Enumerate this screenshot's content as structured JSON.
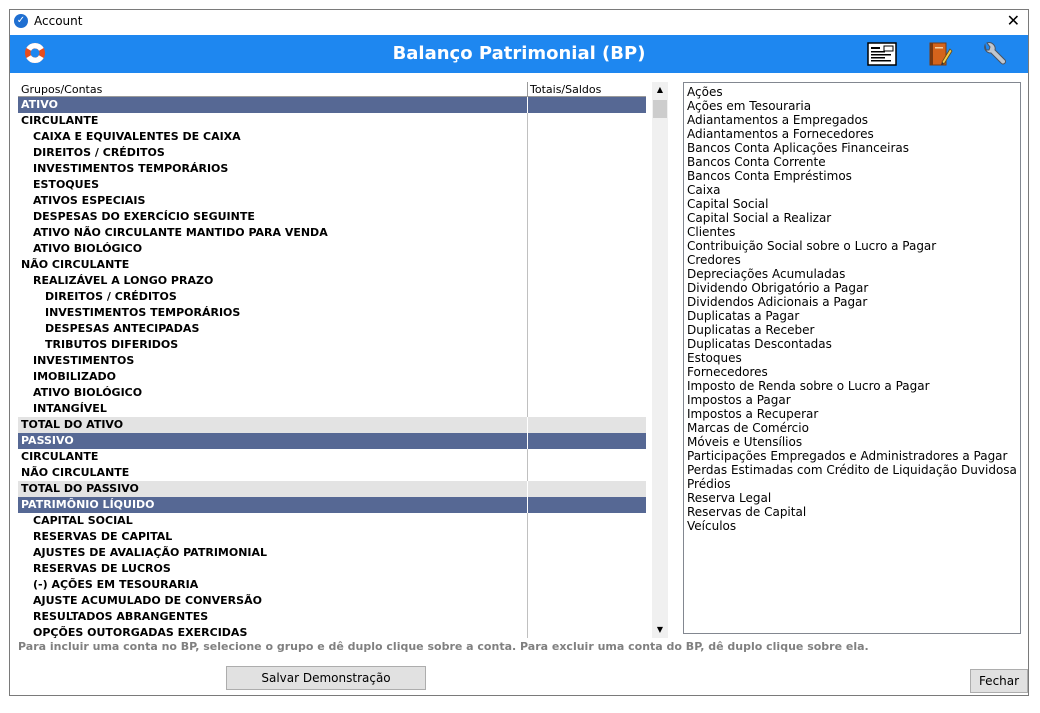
{
  "window": {
    "title": "Account",
    "close": "✕"
  },
  "header": {
    "title": "Balanço Patrimonial (BP)"
  },
  "columns": {
    "group": "Grupos/Contas",
    "totals": "Totais/Saldos"
  },
  "rows": [
    {
      "label": "ATIVO",
      "type": "section",
      "level": 0
    },
    {
      "label": "CIRCULANTE",
      "type": "bold",
      "level": 0
    },
    {
      "label": "CAIXA E EQUIVALENTES DE CAIXA",
      "type": "bold",
      "level": 1
    },
    {
      "label": "DIREITOS / CRÉDITOS",
      "type": "bold",
      "level": 1
    },
    {
      "label": "INVESTIMENTOS TEMPORÁRIOS",
      "type": "bold",
      "level": 1
    },
    {
      "label": "ESTOQUES",
      "type": "bold",
      "level": 1
    },
    {
      "label": "ATIVOS ESPECIAIS",
      "type": "bold",
      "level": 1
    },
    {
      "label": "DESPESAS DO EXERCÍCIO SEGUINTE",
      "type": "bold",
      "level": 1
    },
    {
      "label": "ATIVO NÃO CIRCULANTE MANTIDO PARA VENDA",
      "type": "bold",
      "level": 1
    },
    {
      "label": "ATIVO BIOLÓGICO",
      "type": "bold",
      "level": 1
    },
    {
      "label": "NÃO CIRCULANTE",
      "type": "bold",
      "level": 0
    },
    {
      "label": "REALIZÁVEL A LONGO PRAZO",
      "type": "bold",
      "level": 1
    },
    {
      "label": "DIREITOS / CRÉDITOS",
      "type": "bold",
      "level": 2
    },
    {
      "label": "INVESTIMENTOS TEMPORÁRIOS",
      "type": "bold",
      "level": 2
    },
    {
      "label": "DESPESAS ANTECIPADAS",
      "type": "bold",
      "level": 2
    },
    {
      "label": "TRIBUTOS DIFERIDOS",
      "type": "bold",
      "level": 2
    },
    {
      "label": "INVESTIMENTOS",
      "type": "bold",
      "level": 1
    },
    {
      "label": "IMOBILIZADO",
      "type": "bold",
      "level": 1
    },
    {
      "label": "ATIVO BIOLÓGICO",
      "type": "bold",
      "level": 1
    },
    {
      "label": "INTANGÍVEL",
      "type": "bold",
      "level": 1
    },
    {
      "label": "TOTAL DO ATIVO",
      "type": "total",
      "level": 0
    },
    {
      "label": "PASSIVO",
      "type": "section",
      "level": 0
    },
    {
      "label": "CIRCULANTE",
      "type": "bold",
      "level": 0
    },
    {
      "label": "NÃO CIRCULANTE",
      "type": "bold",
      "level": 0
    },
    {
      "label": "TOTAL DO PASSIVO",
      "type": "total",
      "level": 0
    },
    {
      "label": "PATRIMÔNIO LÍQUIDO",
      "type": "section",
      "level": 0
    },
    {
      "label": "CAPITAL SOCIAL",
      "type": "bold",
      "level": 1
    },
    {
      "label": "RESERVAS DE CAPITAL",
      "type": "bold",
      "level": 1
    },
    {
      "label": "AJUSTES DE AVALIAÇÃO PATRIMONIAL",
      "type": "bold",
      "level": 1
    },
    {
      "label": "RESERVAS DE LUCROS",
      "type": "bold",
      "level": 1
    },
    {
      "label": "(-) AÇÕES EM TESOURARIA",
      "type": "bold",
      "level": 1
    },
    {
      "label": "AJUSTE ACUMULADO DE CONVERSÃO",
      "type": "bold",
      "level": 1
    },
    {
      "label": "RESULTADOS ABRANGENTES",
      "type": "bold",
      "level": 1
    },
    {
      "label": "OPÇÕES OUTORGADAS EXERCIDAS",
      "type": "bold",
      "level": 1
    }
  ],
  "accounts": [
    "Ações",
    "Ações em Tesouraria",
    "Adiantamentos a Empregados",
    "Adiantamentos a Fornecedores",
    "Bancos Conta Aplicações Financeiras",
    "Bancos Conta Corrente",
    "Bancos Conta Empréstimos",
    "Caixa",
    "Capital Social",
    "Capital Social a Realizar",
    "Clientes",
    "Contribuição Social sobre o Lucro a Pagar",
    "Credores",
    "Depreciações Acumuladas",
    "Dividendo Obrigatório a Pagar",
    "Dividendos Adicionais a Pagar",
    "Duplicatas a Pagar",
    "Duplicatas a Receber",
    "Duplicatas Descontadas",
    "Estoques",
    "Fornecedores",
    "Imposto de Renda sobre o Lucro a Pagar",
    "Impostos a Pagar",
    "Impostos a Recuperar",
    "Marcas de Comércio",
    "Móveis e Utensílios",
    "Participações Empregados e Administradores a Pagar",
    "Perdas Estimadas com Crédito de Liquidação Duvidosa - PECLD",
    "Prédios",
    "Reserva Legal",
    "Reservas de Capital",
    "Veículos"
  ],
  "hint": "Para incluir uma conta no BP, selecione o grupo e dê duplo clique sobre a conta. Para excluir uma conta do BP, dê duplo clique sobre ela.",
  "buttons": {
    "save": "Salvar Demonstração",
    "close": "Fechar"
  },
  "colors": {
    "header": "#1e87f0",
    "section": "#566894",
    "total": "#e3e3e3"
  },
  "icons": {
    "header_left": "lifebuoy-icon",
    "header_right": [
      "report-icon",
      "notebook-icon",
      "wrench-icon"
    ]
  }
}
